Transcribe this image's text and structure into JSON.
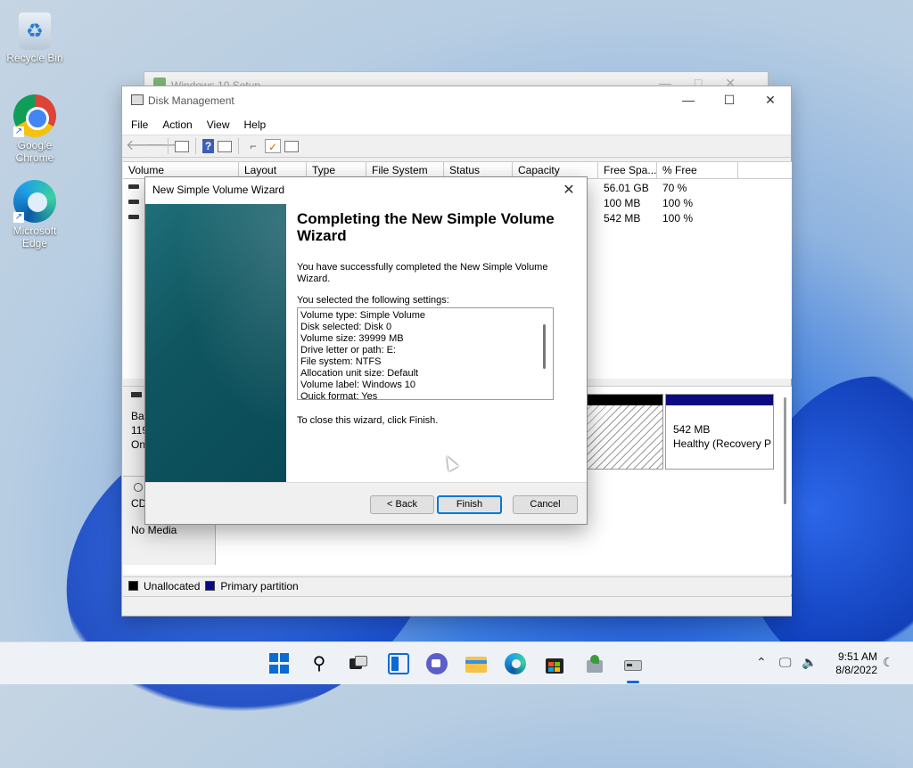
{
  "desktop": {
    "icons": [
      {
        "label": "Recycle Bin"
      },
      {
        "label": "Google Chrome"
      },
      {
        "label": "Microsoft Edge"
      }
    ]
  },
  "setup_window": {
    "title": "Windows 10 Setup"
  },
  "disk_mgmt": {
    "title": "Disk Management",
    "menu": [
      "File",
      "Action",
      "View",
      "Help"
    ],
    "columns": [
      "Volume",
      "Layout",
      "Type",
      "File System",
      "Status",
      "Capacity",
      "Free Spa...",
      "% Free"
    ],
    "rows": [
      {
        "free": "56.01 GB",
        "pct": "70 %"
      },
      {
        "free": "100 MB",
        "pct": "100 %"
      },
      {
        "free": "542 MB",
        "pct": "100 %"
      }
    ],
    "disk0": {
      "label_partial": "Bas",
      "size_partial": "119",
      "status_partial": "On"
    },
    "cd": {
      "label_partial": "CD",
      "media": "No Media"
    },
    "recovery": {
      "size": "542 MB",
      "status": "Healthy (Recovery P"
    },
    "legend": {
      "unallocated": "Unallocated",
      "primary": "Primary partition"
    },
    "colors": {
      "primary": "#0a0a82",
      "unallocated": "#000000"
    }
  },
  "wizard": {
    "title": "New Simple Volume Wizard",
    "heading": "Completing the New Simple Volume Wizard",
    "success": "You have successfully completed the New Simple Volume Wizard.",
    "selected_label": "You selected the following settings:",
    "settings": [
      "Volume type: Simple Volume",
      "Disk selected: Disk 0",
      "Volume size: 39999 MB",
      "Drive letter or path: E:",
      "File system: NTFS",
      "Allocation unit size: Default",
      "Volume label: Windows 10",
      "Quick format: Yes"
    ],
    "close_hint": "To close this wizard, click Finish.",
    "buttons": {
      "back": "< Back",
      "finish": "Finish",
      "cancel": "Cancel"
    }
  },
  "taskbar": {
    "time": "9:51 AM",
    "date": "8/8/2022"
  }
}
